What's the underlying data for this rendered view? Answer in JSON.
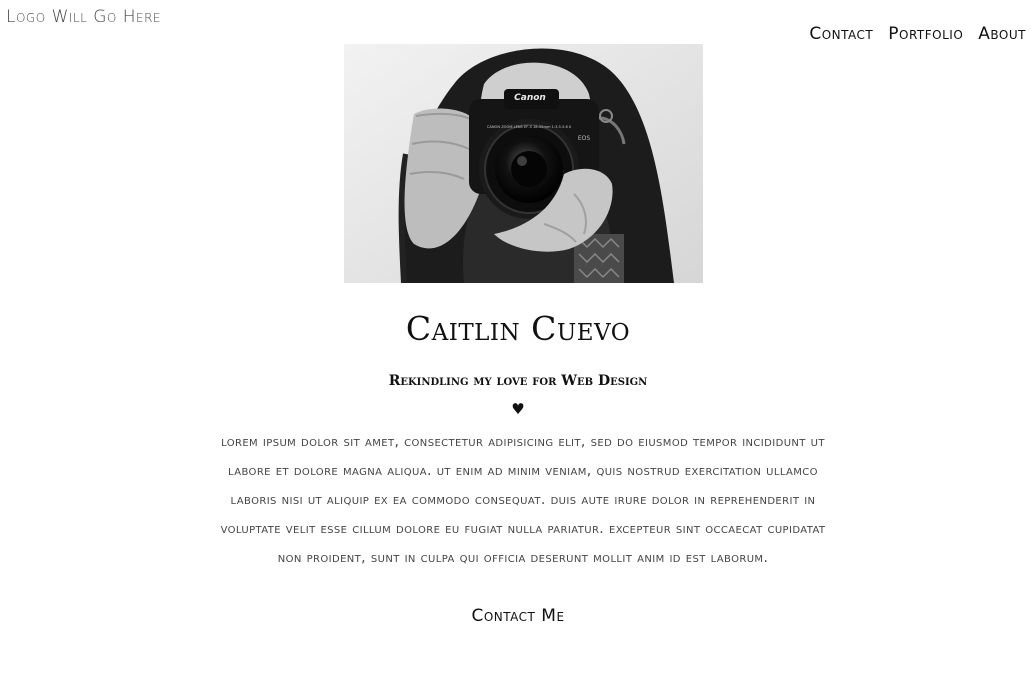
{
  "header": {
    "logo_text": "Logo Will Go Here",
    "nav": {
      "contact": "Contact",
      "portfolio": "Portfolio",
      "about": "About"
    }
  },
  "hero": {
    "camera_brand": "Canon",
    "lens_text": "CANON ZOOM LENS EF-S 18-55mm 1:3.5-5.6 II",
    "body_badge": "EOS",
    "tone": "black-and-white photograph"
  },
  "profile": {
    "name": "Caitlin Cuevo",
    "tagline": "Rekindling my love for Web Design",
    "divider_icon": "heart-icon",
    "divider_glyph": "♥",
    "bio": "Lorem ipsum dolor sit amet, consectetur adipisicing elit, sed do eiusmod tempor incididunt ut labore et dolore magna aliqua. Ut enim ad minim veniam, quis nostrud exercitation ullamco laboris nisi ut aliquip ex ea commodo consequat. Duis aute irure dolor in reprehenderit in voluptate velit esse cillum dolore eu fugiat nulla pariatur. Excepteur sint occaecat cupidatat non proident, sunt in culpa qui officia deserunt mollit anim id est laborum.",
    "cta_label": "Contact Me"
  }
}
